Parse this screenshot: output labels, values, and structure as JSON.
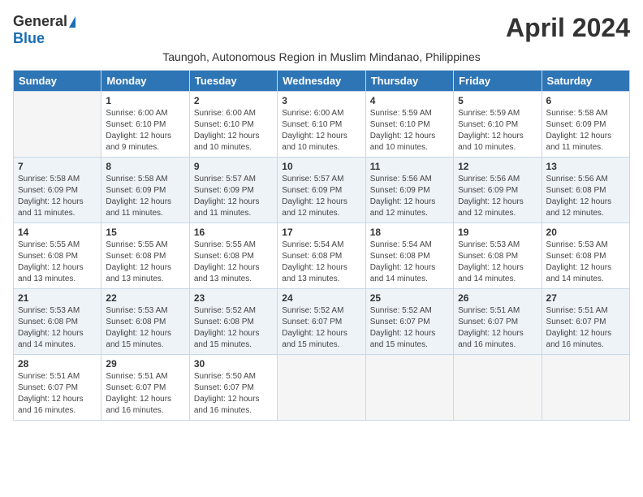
{
  "header": {
    "logo_general": "General",
    "logo_blue": "Blue",
    "month_title": "April 2024",
    "subtitle": "Taungoh, Autonomous Region in Muslim Mindanao, Philippines"
  },
  "calendar": {
    "days_of_week": [
      "Sunday",
      "Monday",
      "Tuesday",
      "Wednesday",
      "Thursday",
      "Friday",
      "Saturday"
    ],
    "weeks": [
      [
        {
          "day": "",
          "info": ""
        },
        {
          "day": "1",
          "info": "Sunrise: 6:00 AM\nSunset: 6:10 PM\nDaylight: 12 hours\nand 9 minutes."
        },
        {
          "day": "2",
          "info": "Sunrise: 6:00 AM\nSunset: 6:10 PM\nDaylight: 12 hours\nand 10 minutes."
        },
        {
          "day": "3",
          "info": "Sunrise: 6:00 AM\nSunset: 6:10 PM\nDaylight: 12 hours\nand 10 minutes."
        },
        {
          "day": "4",
          "info": "Sunrise: 5:59 AM\nSunset: 6:10 PM\nDaylight: 12 hours\nand 10 minutes."
        },
        {
          "day": "5",
          "info": "Sunrise: 5:59 AM\nSunset: 6:10 PM\nDaylight: 12 hours\nand 10 minutes."
        },
        {
          "day": "6",
          "info": "Sunrise: 5:58 AM\nSunset: 6:09 PM\nDaylight: 12 hours\nand 11 minutes."
        }
      ],
      [
        {
          "day": "7",
          "info": "Sunrise: 5:58 AM\nSunset: 6:09 PM\nDaylight: 12 hours\nand 11 minutes."
        },
        {
          "day": "8",
          "info": "Sunrise: 5:58 AM\nSunset: 6:09 PM\nDaylight: 12 hours\nand 11 minutes."
        },
        {
          "day": "9",
          "info": "Sunrise: 5:57 AM\nSunset: 6:09 PM\nDaylight: 12 hours\nand 11 minutes."
        },
        {
          "day": "10",
          "info": "Sunrise: 5:57 AM\nSunset: 6:09 PM\nDaylight: 12 hours\nand 12 minutes."
        },
        {
          "day": "11",
          "info": "Sunrise: 5:56 AM\nSunset: 6:09 PM\nDaylight: 12 hours\nand 12 minutes."
        },
        {
          "day": "12",
          "info": "Sunrise: 5:56 AM\nSunset: 6:09 PM\nDaylight: 12 hours\nand 12 minutes."
        },
        {
          "day": "13",
          "info": "Sunrise: 5:56 AM\nSunset: 6:08 PM\nDaylight: 12 hours\nand 12 minutes."
        }
      ],
      [
        {
          "day": "14",
          "info": "Sunrise: 5:55 AM\nSunset: 6:08 PM\nDaylight: 12 hours\nand 13 minutes."
        },
        {
          "day": "15",
          "info": "Sunrise: 5:55 AM\nSunset: 6:08 PM\nDaylight: 12 hours\nand 13 minutes."
        },
        {
          "day": "16",
          "info": "Sunrise: 5:55 AM\nSunset: 6:08 PM\nDaylight: 12 hours\nand 13 minutes."
        },
        {
          "day": "17",
          "info": "Sunrise: 5:54 AM\nSunset: 6:08 PM\nDaylight: 12 hours\nand 13 minutes."
        },
        {
          "day": "18",
          "info": "Sunrise: 5:54 AM\nSunset: 6:08 PM\nDaylight: 12 hours\nand 14 minutes."
        },
        {
          "day": "19",
          "info": "Sunrise: 5:53 AM\nSunset: 6:08 PM\nDaylight: 12 hours\nand 14 minutes."
        },
        {
          "day": "20",
          "info": "Sunrise: 5:53 AM\nSunset: 6:08 PM\nDaylight: 12 hours\nand 14 minutes."
        }
      ],
      [
        {
          "day": "21",
          "info": "Sunrise: 5:53 AM\nSunset: 6:08 PM\nDaylight: 12 hours\nand 14 minutes."
        },
        {
          "day": "22",
          "info": "Sunrise: 5:53 AM\nSunset: 6:08 PM\nDaylight: 12 hours\nand 15 minutes."
        },
        {
          "day": "23",
          "info": "Sunrise: 5:52 AM\nSunset: 6:08 PM\nDaylight: 12 hours\nand 15 minutes."
        },
        {
          "day": "24",
          "info": "Sunrise: 5:52 AM\nSunset: 6:07 PM\nDaylight: 12 hours\nand 15 minutes."
        },
        {
          "day": "25",
          "info": "Sunrise: 5:52 AM\nSunset: 6:07 PM\nDaylight: 12 hours\nand 15 minutes."
        },
        {
          "day": "26",
          "info": "Sunrise: 5:51 AM\nSunset: 6:07 PM\nDaylight: 12 hours\nand 16 minutes."
        },
        {
          "day": "27",
          "info": "Sunrise: 5:51 AM\nSunset: 6:07 PM\nDaylight: 12 hours\nand 16 minutes."
        }
      ],
      [
        {
          "day": "28",
          "info": "Sunrise: 5:51 AM\nSunset: 6:07 PM\nDaylight: 12 hours\nand 16 minutes."
        },
        {
          "day": "29",
          "info": "Sunrise: 5:51 AM\nSunset: 6:07 PM\nDaylight: 12 hours\nand 16 minutes."
        },
        {
          "day": "30",
          "info": "Sunrise: 5:50 AM\nSunset: 6:07 PM\nDaylight: 12 hours\nand 16 minutes."
        },
        {
          "day": "",
          "info": ""
        },
        {
          "day": "",
          "info": ""
        },
        {
          "day": "",
          "info": ""
        },
        {
          "day": "",
          "info": ""
        }
      ]
    ]
  }
}
